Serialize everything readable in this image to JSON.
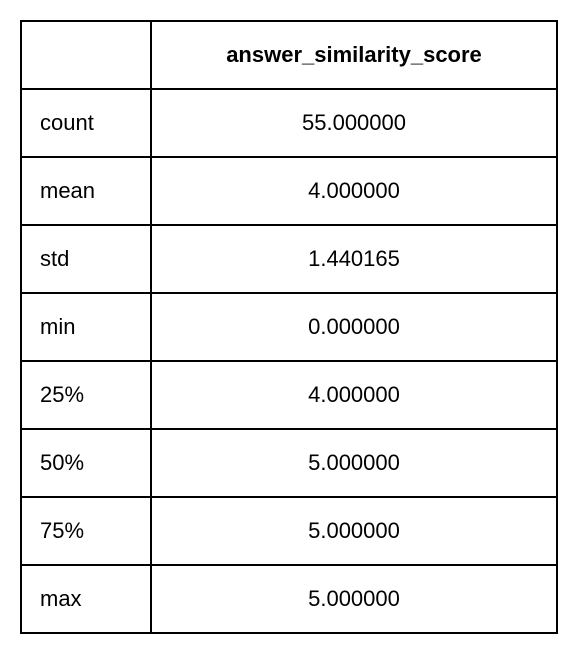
{
  "chart_data": {
    "type": "table",
    "title": "",
    "columns": [
      "",
      "answer_similarity_score"
    ],
    "rows": [
      {
        "stat": "count",
        "value": "55.000000"
      },
      {
        "stat": "mean",
        "value": "4.000000"
      },
      {
        "stat": "std",
        "value": "1.440165"
      },
      {
        "stat": "min",
        "value": "0.000000"
      },
      {
        "stat": "25%",
        "value": "4.000000"
      },
      {
        "stat": "50%",
        "value": "5.000000"
      },
      {
        "stat": "75%",
        "value": "5.000000"
      },
      {
        "stat": "max",
        "value": "5.000000"
      }
    ]
  },
  "header": {
    "empty": "",
    "column": "answer_similarity_score"
  },
  "rows": {
    "0": {
      "label": "count",
      "value": "55.000000"
    },
    "1": {
      "label": "mean",
      "value": "4.000000"
    },
    "2": {
      "label": "std",
      "value": "1.440165"
    },
    "3": {
      "label": "min",
      "value": "0.000000"
    },
    "4": {
      "label": "25%",
      "value": "4.000000"
    },
    "5": {
      "label": "50%",
      "value": "5.000000"
    },
    "6": {
      "label": "75%",
      "value": "5.000000"
    },
    "7": {
      "label": "max",
      "value": "5.000000"
    }
  }
}
